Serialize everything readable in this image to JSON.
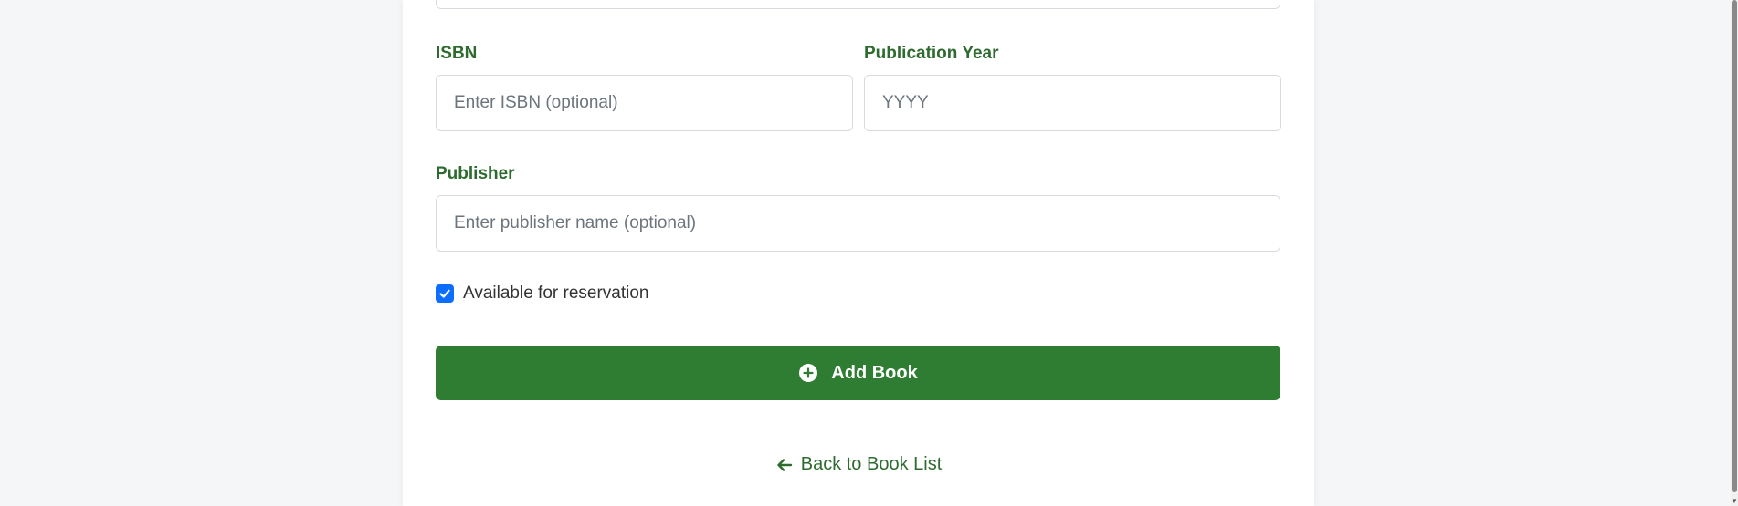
{
  "form": {
    "isbn": {
      "label": "ISBN",
      "placeholder": "Enter ISBN (optional)",
      "value": ""
    },
    "publication_year": {
      "label": "Publication Year",
      "placeholder": "YYYY",
      "value": ""
    },
    "publisher": {
      "label": "Publisher",
      "placeholder": "Enter publisher name (optional)",
      "value": ""
    },
    "available": {
      "label": "Available for reservation",
      "checked": true
    },
    "submit": {
      "label": "Add Book",
      "icon": "plus-circle-icon"
    },
    "back_link": {
      "label": "Back to Book List",
      "icon": "arrow-left-icon"
    }
  },
  "colors": {
    "accent_green": "#2e7d32",
    "label_green": "#2e6b2f",
    "checkbox_blue": "#0d6efd",
    "background": "#f5f6f8"
  }
}
